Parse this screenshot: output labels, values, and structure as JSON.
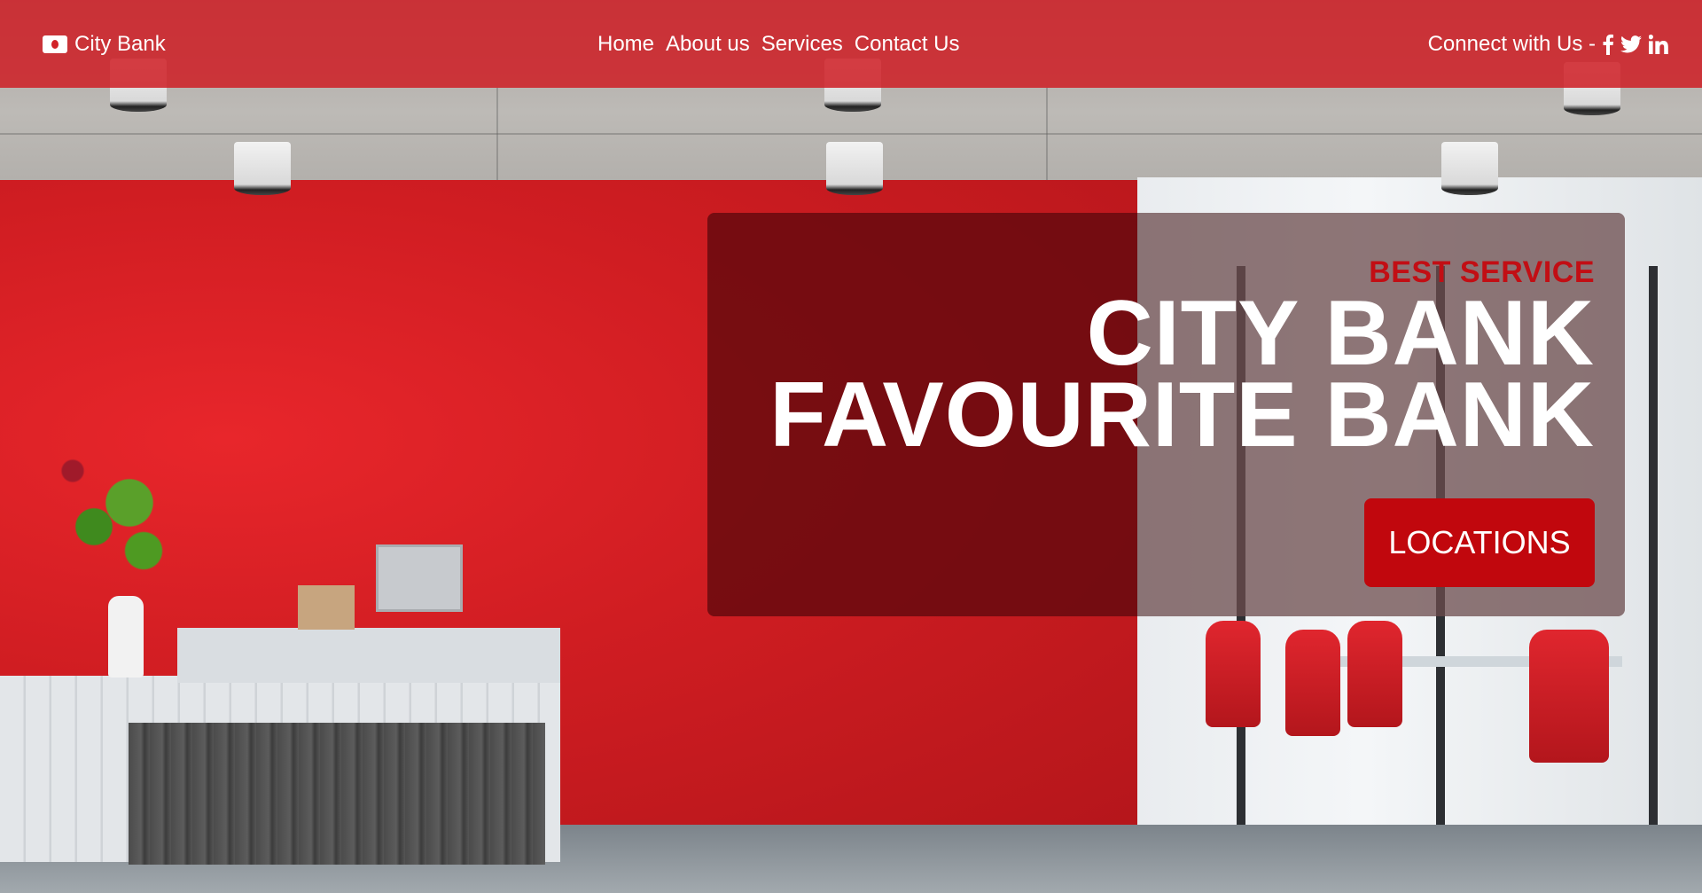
{
  "brand": {
    "name": "City Bank",
    "icon": "money-bill-icon"
  },
  "nav": {
    "items": [
      {
        "label": "Home"
      },
      {
        "label": "About us"
      },
      {
        "label": "Services"
      },
      {
        "label": "Contact Us"
      }
    ]
  },
  "connect": {
    "label": "Connect with Us -",
    "icons": [
      "facebook-icon",
      "twitter-icon",
      "linkedin-icon"
    ]
  },
  "hero": {
    "eyebrow": "BEST SERVICE",
    "headline_line1": "CITY BANK",
    "headline_line2": "FAVOURITE BANK",
    "cta_label": "LOCATIONS"
  },
  "colors": {
    "navbar": "#ce1e25",
    "accent": "#c1070d",
    "text_light": "#ffffff"
  }
}
